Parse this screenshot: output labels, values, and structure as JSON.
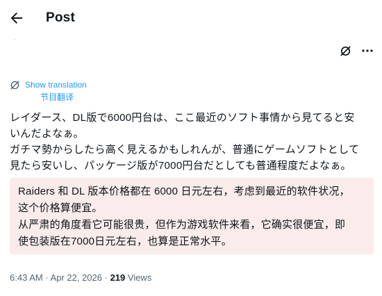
{
  "header": {
    "title": "Post"
  },
  "translate": {
    "label": "Show translation",
    "sub": "节目翻译"
  },
  "original": {
    "lines": [
      "レイダース、DL版で6000円台は、ここ最近のソフト事情から見てると安",
      "いんだよなぁ。",
      "ガチマ勢からしたら高く見えるかもしれんが、普通にゲームソフトとして",
      "見たら安いし、パッケージ版が7000円台だとしても普通程度だよなぁ。"
    ]
  },
  "translation": {
    "lines": [
      "Raiders 和 DL 版本价格都在 6000 日元左右，考虑到最近的软件状况，",
      "这个价格算便宜。",
      "从严肃的角度看它可能很贵，但作为游戏软件来看，它确实很便宜，即",
      "使包装版在7000日元左右，也算是正常水平。"
    ]
  },
  "meta": {
    "time": "6:43 AM",
    "sep1": " · ",
    "date": "Apr 22, 2026",
    "sep2": " · ",
    "views_count": "219",
    "views_label": " Views"
  },
  "icons": {
    "back": "arrow-left-icon",
    "grok": "grok-icon",
    "more": "more-icon",
    "translate": "translate-icon"
  },
  "colors": {
    "link": "#1d9bf0",
    "translation_bg": "#f9eceb",
    "muted": "#536471",
    "text": "#0f1419"
  }
}
